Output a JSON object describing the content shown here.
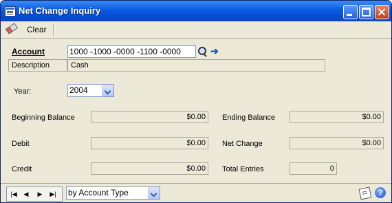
{
  "window": {
    "title": "Net Change Inquiry"
  },
  "toolbar": {
    "clear_label": "Clear"
  },
  "form": {
    "account_label": "Account",
    "account_value": "1000 -1000 -0000 -1100 -0000",
    "description_label": "Description",
    "description_value": "Cash",
    "year_label": "Year:",
    "year_value": "2004",
    "beginning_balance_label": "Beginning Balance",
    "beginning_balance_value": "$0.00",
    "debit_label": "Debit",
    "debit_value": "$0.00",
    "credit_label": "Credit",
    "credit_value": "$0.00",
    "ending_balance_label": "Ending Balance",
    "ending_balance_value": "$0.00",
    "net_change_label": "Net Change",
    "net_change_value": "$0.00",
    "total_entries_label": "Total Entries",
    "total_entries_value": "0"
  },
  "statusbar": {
    "nav": {
      "first": "|◀",
      "prev": "◀",
      "next": "▶",
      "last": "▶|"
    },
    "sort_value": "by Account Type",
    "help_glyph": "?"
  },
  "icons": {
    "app": "window-form-icon",
    "clear": "eraser-icon",
    "lookup": "magnifier-icon",
    "goto": "arrow-right-icon",
    "notes": "note-icon",
    "help": "help-icon"
  },
  "colors": {
    "titlebar": "#0a5ae0",
    "window_bg": "#ece9d8",
    "close_button": "#c43c18",
    "goto_arrow": "#1a4fc8"
  }
}
